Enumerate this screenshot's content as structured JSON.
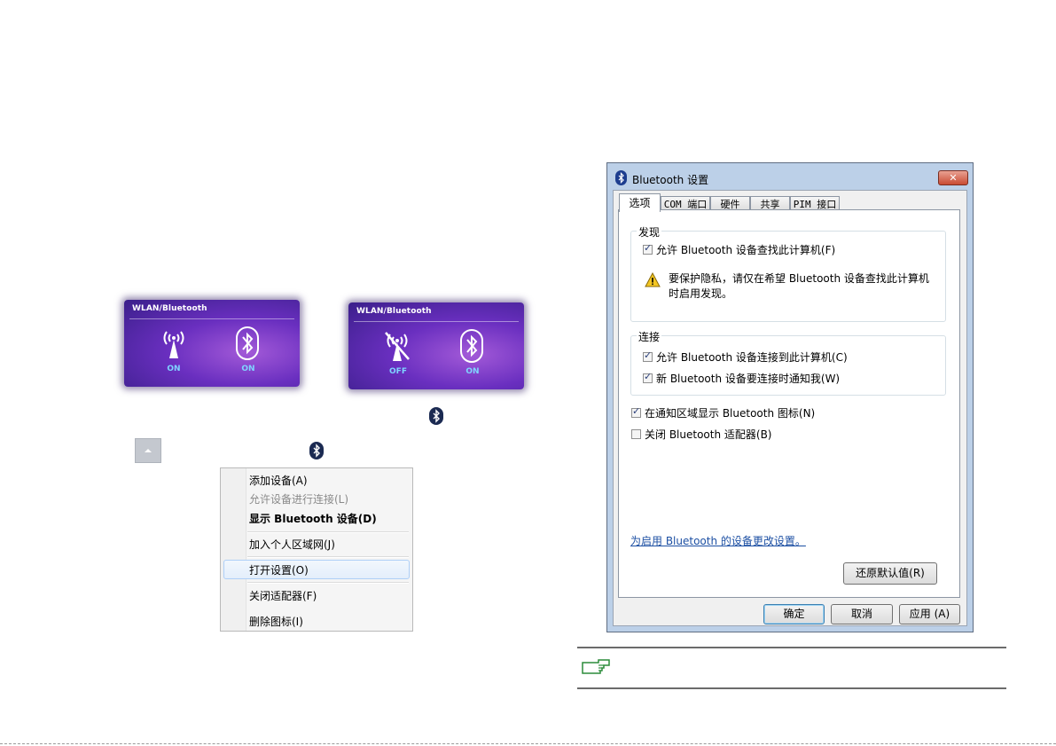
{
  "osd_left": {
    "title": "WLAN/Bluetooth",
    "wlan_state": "ON",
    "bt_state": "ON"
  },
  "osd_right": {
    "title": "WLAN/Bluetooth",
    "wlan_state": "OFF",
    "bt_state": "ON"
  },
  "context_menu": {
    "items": [
      "添加设备(A)",
      "允许设备进行连接(L)",
      "显示 Bluetooth 设备(D)",
      "加入个人区域网(J)",
      "打开设置(O)",
      "关闭适配器(F)",
      "删除图标(I)"
    ]
  },
  "dialog": {
    "title": "Bluetooth 设置",
    "close_label": "✕",
    "tabs": [
      "选项",
      "COM 端口",
      "硬件",
      "共享",
      "PIM 接口"
    ],
    "discovery": {
      "label": "发现",
      "allow_find": "允许 Bluetooth 设备查找此计算机(F)",
      "warning": "要保护隐私，请仅在希望 Bluetooth 设备查找此计算机时启用发现。"
    },
    "connections": {
      "label": "连接",
      "allow_connect": "允许 Bluetooth 设备连接到此计算机(C)",
      "notify": "新 Bluetooth 设备要连接时通知我(W)"
    },
    "show_icon": "在通知区域显示 Bluetooth 图标(N)",
    "turn_off": "关闭 Bluetooth 适配器(B)",
    "change_link": "为启用 Bluetooth 的设备更改设置。",
    "restore_defaults": "还原默认值(R)",
    "ok": "确定",
    "cancel": "取消",
    "apply": "应用 (A)"
  },
  "colors": {
    "osd_state": "#7fd4ff",
    "link": "#1c4fa3",
    "dialog_frame": "#bcd0e8"
  }
}
